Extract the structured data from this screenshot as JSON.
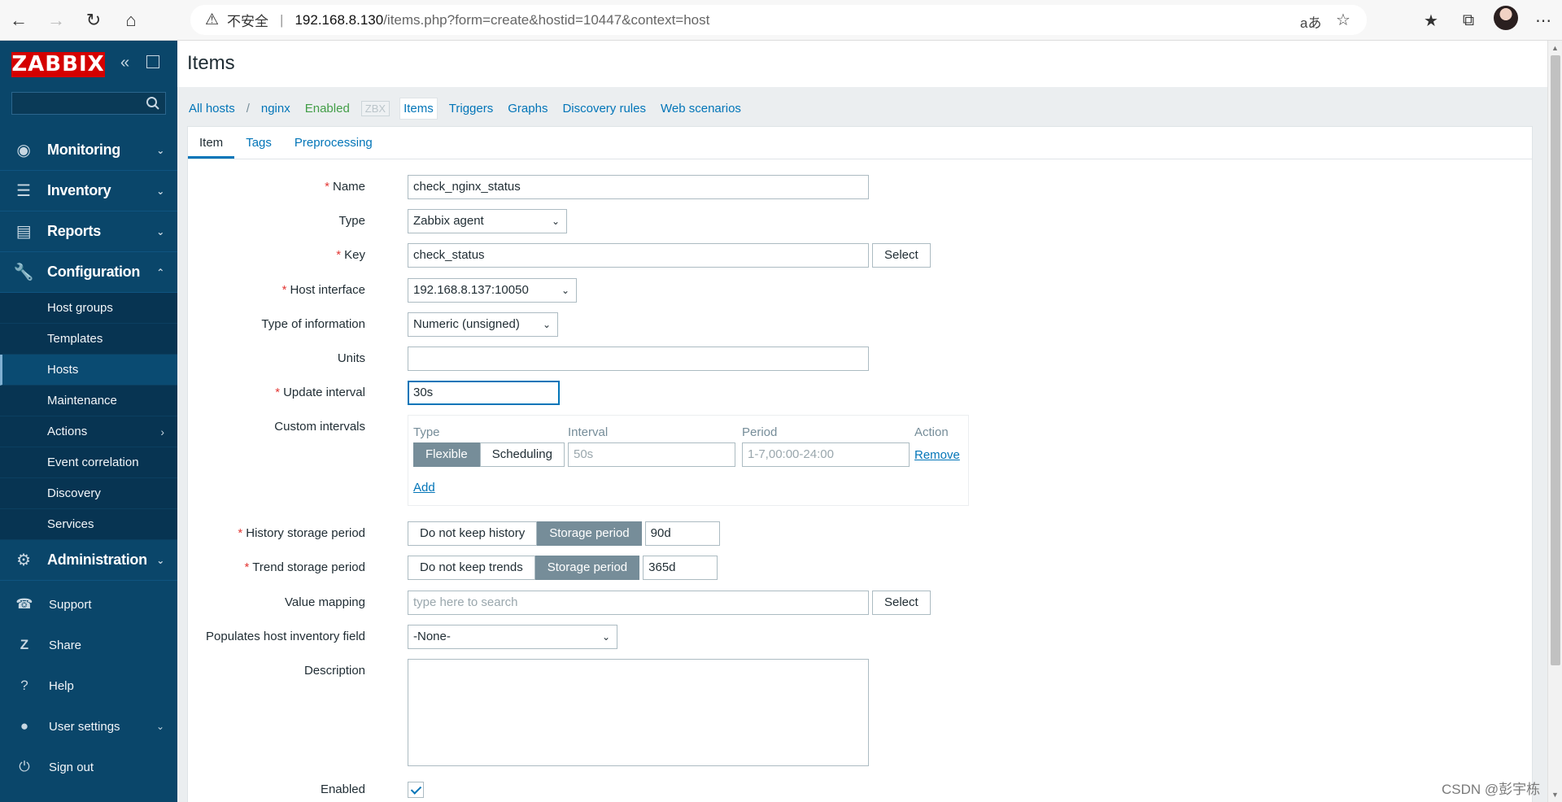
{
  "browser": {
    "insecure_label": "不安全",
    "url_host": "192.168.8.130",
    "url_path": "/items.php?form=create&hostid=10447&context=host",
    "read_aloud_label": "aあ"
  },
  "sidebar": {
    "logo": "ZABBIX",
    "menu": [
      {
        "label": "Monitoring",
        "icon": "eye-icon"
      },
      {
        "label": "Inventory",
        "icon": "list-icon"
      },
      {
        "label": "Reports",
        "icon": "bar-chart-icon"
      },
      {
        "label": "Configuration",
        "icon": "wrench-icon"
      }
    ],
    "config_submenu": [
      "Host groups",
      "Templates",
      "Hosts",
      "Maintenance",
      "Actions",
      "Event correlation",
      "Discovery",
      "Services"
    ],
    "admin_label": "Administration",
    "bottom": [
      {
        "label": "Support",
        "icon": "headset-icon"
      },
      {
        "label": "Share",
        "icon": "share-z-icon"
      },
      {
        "label": "Help",
        "icon": "help-icon"
      },
      {
        "label": "User settings",
        "icon": "user-icon"
      },
      {
        "label": "Sign out",
        "icon": "power-icon"
      }
    ]
  },
  "page": {
    "title": "Items"
  },
  "breadcrumbs": {
    "all_hosts": "All hosts",
    "separator": "/",
    "host": "nginx",
    "status": "Enabled",
    "zbx": "ZBX",
    "items": "Items",
    "triggers": "Triggers",
    "graphs": "Graphs",
    "discovery": "Discovery rules",
    "web": "Web scenarios"
  },
  "tabs": [
    "Item",
    "Tags",
    "Preprocessing"
  ],
  "form": {
    "name_label": "Name",
    "name_value": "check_nginx_status",
    "type_label": "Type",
    "type_value": "Zabbix agent",
    "key_label": "Key",
    "key_value": "check_status",
    "select_label": "Select",
    "host_interface_label": "Host interface",
    "host_interface_value": "192.168.8.137:10050",
    "type_info_label": "Type of information",
    "type_info_value": "Numeric (unsigned)",
    "units_label": "Units",
    "units_value": "",
    "update_interval_label": "Update interval",
    "update_interval_value": "30s",
    "custom_intervals_label": "Custom intervals",
    "ci_headers": {
      "type": "Type",
      "interval": "Interval",
      "period": "Period",
      "action": "Action"
    },
    "ci_flexible": "Flexible",
    "ci_scheduling": "Scheduling",
    "ci_interval_placeholder": "50s",
    "ci_period_placeholder": "1-7,00:00-24:00",
    "ci_remove": "Remove",
    "ci_add": "Add",
    "history_label": "History storage period",
    "history_no_keep": "Do not keep history",
    "history_storage": "Storage period",
    "history_value": "90d",
    "trend_label": "Trend storage period",
    "trend_no_keep": "Do not keep trends",
    "trend_storage": "Storage period",
    "trend_value": "365d",
    "value_mapping_label": "Value mapping",
    "value_mapping_placeholder": "type here to search",
    "inventory_label": "Populates host inventory field",
    "inventory_value": "-None-",
    "description_label": "Description",
    "enabled_label": "Enabled"
  },
  "watermark": "CSDN @彭宇栋"
}
